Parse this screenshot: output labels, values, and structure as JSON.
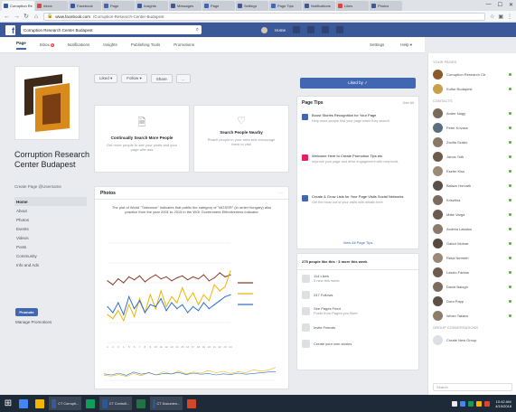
{
  "browser": {
    "tabs": [
      {
        "label": "Corruption Rese",
        "color": "#3b5998"
      },
      {
        "label": "Inbox",
        "color": "#db4437"
      },
      {
        "label": "Facebook",
        "color": "#3b5998"
      },
      {
        "label": "Page",
        "color": "#4267b2"
      },
      {
        "label": "Insights",
        "color": "#3b5998"
      },
      {
        "label": "Messages",
        "color": "#3b5998"
      },
      {
        "label": "Page",
        "color": "#4267b2"
      },
      {
        "label": "Settings",
        "color": "#3b5998"
      },
      {
        "label": "Page Tips",
        "color": "#4267b2"
      },
      {
        "label": "Notifications",
        "color": "#3b5998"
      },
      {
        "label": "Likes",
        "color": "#db4437"
      },
      {
        "label": "Photos",
        "color": "#3b5998"
      }
    ],
    "address_domain": "www.facebook.com",
    "address_rest": "/Corruption-Research-Center-Budapest",
    "window_controls": [
      "—",
      "☐",
      "✕"
    ]
  },
  "fb": {
    "search_value": "Corruption Research Center Budapest",
    "user_name": "Home",
    "home_label": "Home"
  },
  "page_tabs": {
    "items": [
      {
        "label": "Page",
        "active": true
      },
      {
        "label": "Inbox",
        "badge": "6"
      },
      {
        "label": "Notifications"
      },
      {
        "label": "Insights"
      },
      {
        "label": "Publishing Tools"
      },
      {
        "label": "Promotions"
      }
    ],
    "right": [
      "Settings",
      "Help ▾"
    ]
  },
  "left": {
    "page_name": "Corruption Research Center Budapest",
    "handle": "Create Page @Username",
    "nav": [
      "Home",
      "About",
      "Photos",
      "Events",
      "Videos",
      "Posts",
      "Community",
      "Info and Ads"
    ],
    "promote": "Promote",
    "manage": "Manage Promotions"
  },
  "middle": {
    "actions": [
      "Liked ▾",
      "Follow ▾",
      "Share",
      "..."
    ],
    "cards": [
      {
        "icon": "🗎",
        "title": "Continually Search More People",
        "sub": "Get more people to see your posts and your page with ads"
      },
      {
        "icon": "♡",
        "title": "Search People Nearby",
        "sub": "Reach people in your area and encourage them to visit"
      }
    ],
    "chart_title": "Photos",
    "chart_caption": "The plot of World \"Tolerance\" Indicates that public the category of \"MGSSR\" (in order Hungary) also practice from the year 2001 to 2015 in the WGI Government Effectiveness Indicator",
    "chart_legend": [
      "HU",
      "CZ",
      "SK"
    ],
    "chart_colors": [
      "#8b3a2a",
      "#f0b400",
      "#2e6fd1"
    ]
  },
  "chart_data": {
    "type": "line",
    "title": "",
    "xlabel": "",
    "ylabel": "",
    "x": [
      "1",
      "2",
      "3",
      "4",
      "5",
      "6",
      "7",
      "8",
      "9",
      "10",
      "11",
      "12",
      "13",
      "14",
      "15",
      "16",
      "17",
      "18",
      "19",
      "20",
      "21",
      "22",
      "23",
      "24"
    ],
    "ylim": [
      0,
      100
    ],
    "series": [
      {
        "name": "",
        "values": [
          62,
          58,
          64,
          60,
          66,
          63,
          67,
          61,
          65,
          68,
          64,
          66,
          62,
          65,
          67,
          63,
          66,
          64,
          68,
          62,
          65,
          70,
          66,
          68
        ]
      },
      {
        "name": "",
        "values": [
          28,
          24,
          32,
          22,
          38,
          26,
          44,
          30,
          48,
          34,
          52,
          36,
          46,
          40,
          55,
          42,
          50,
          38,
          48,
          42,
          58,
          52,
          56,
          72
        ]
      },
      {
        "name": "",
        "values": [
          36,
          30,
          40,
          28,
          46,
          34,
          42,
          30,
          38,
          36,
          44,
          32,
          40,
          34,
          38,
          30,
          36,
          32,
          40,
          34,
          38,
          42,
          46,
          48
        ]
      }
    ]
  },
  "right": {
    "like_button": "Liked by ✓",
    "tips_title": "Page Tips",
    "tips_see_all": "See All",
    "tips": [
      {
        "title": "Boost Stories Recognition for Your Page",
        "desc": "Help more people find your page when they search",
        "color": "#4267b2"
      },
      {
        "title": "Welcome Here to Create Promotion Tips etc",
        "desc": "Improve your page and drive engagement with new tools",
        "color": "#e91e63"
      },
      {
        "title": "Create & Grow Lists for Your Page Visits Social Networks",
        "desc": "Get the most out of your visits with details here",
        "color": "#4267b2"
      }
    ],
    "tips_footer": "View All Page Tips",
    "likes_header": "275 people like this · 3 more this week",
    "likes_rows": [
      {
        "label": "114 Likes",
        "sub": "3 new this week"
      },
      {
        "label": "247 Follows",
        "sub": ""
      },
      {
        "label": "See Pages Feed",
        "sub": "Posts from Pages you liked"
      },
      {
        "label": "Invite Friends",
        "sub": ""
      },
      {
        "label": "Create your own stories",
        "sub": ""
      }
    ]
  },
  "chat": {
    "section1": "YOUR PAGES",
    "pages": [
      {
        "name": "Corruption Research Ctr",
        "color": "#8b5a2b"
      },
      {
        "name": "Kultur Budapest",
        "color": "#caa048"
      }
    ],
    "section2": "CONTACTS",
    "contacts": [
      {
        "name": "Ander Nagy",
        "color": "#7a6a58"
      },
      {
        "name": "Peter Kovacs",
        "color": "#5a6e80"
      },
      {
        "name": "Zsofia Szabo",
        "color": "#8a7766"
      },
      {
        "name": "Janos Toth",
        "color": "#6c5a4a"
      },
      {
        "name": "Eszter Kiss",
        "color": "#9a8a78"
      },
      {
        "name": "Balazs Horvath",
        "color": "#5b5048"
      },
      {
        "name": "Krisztina",
        "color": "#7b6a5e"
      },
      {
        "name": "Mate Varga",
        "color": "#6a5a50"
      },
      {
        "name": "Andrea Lakatos",
        "color": "#8c7b6b"
      },
      {
        "name": "Gabor Molnar",
        "color": "#564a40"
      },
      {
        "name": "Reka Nemeth",
        "color": "#9b8878"
      },
      {
        "name": "Laszlo Farkas",
        "color": "#6e5d4e"
      },
      {
        "name": "David Balogh",
        "color": "#7d6b5b"
      },
      {
        "name": "Dora Papp",
        "color": "#5e5046"
      },
      {
        "name": "Istvan Takacs",
        "color": "#8e7c6a"
      }
    ],
    "section3": "GROUP CONVERSATIONS",
    "group": "Create New Group",
    "search_placeholder": "Search"
  },
  "taskbar": {
    "apps": [
      {
        "label": "",
        "color": "#4285f4"
      },
      {
        "label": "",
        "color": "#f4b400"
      },
      {
        "label": "CT Corrupti...",
        "color": "#3b5998"
      },
      {
        "label": "",
        "color": "#0f9d58"
      },
      {
        "label": "CT Controll...",
        "color": "#2b579a"
      },
      {
        "label": "",
        "color": "#217346"
      },
      {
        "label": "CT Documen...",
        "color": "#2b579a"
      },
      {
        "label": "",
        "color": "#d24726"
      }
    ],
    "time": "10:42 AM",
    "date": "4/10/2018"
  }
}
